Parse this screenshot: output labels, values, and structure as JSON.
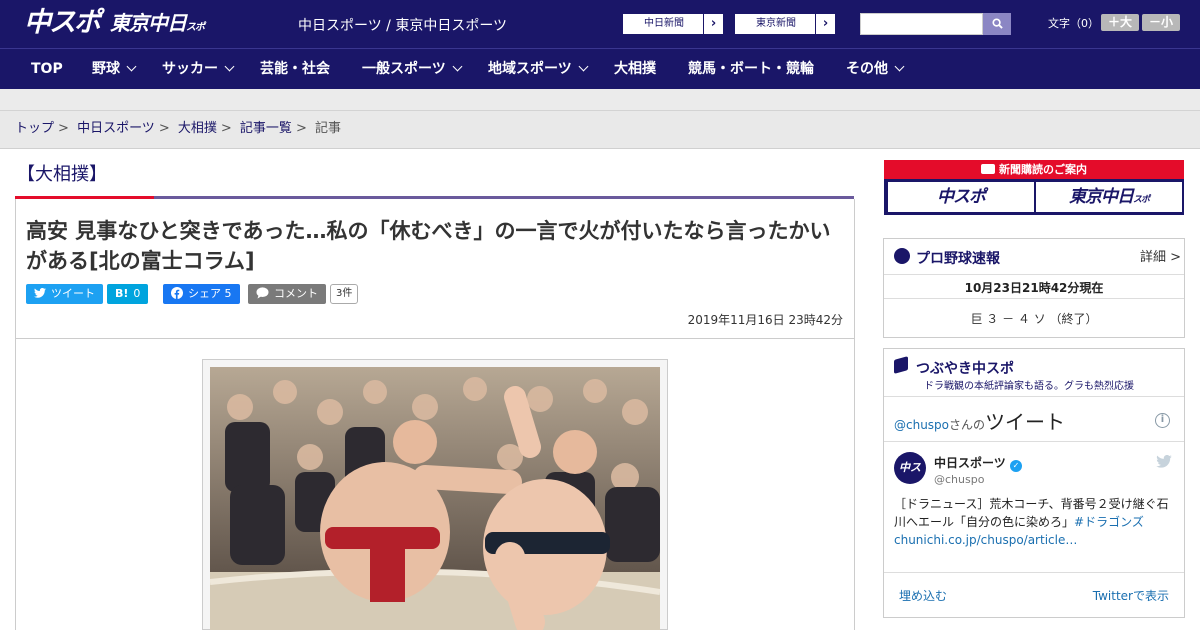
{
  "header": {
    "logo_chuspo": "中スポ",
    "logo_tokyo": "東京中日",
    "logo_tokyo_small": "スポ",
    "site_name": "中日スポーツ / 東京中日スポーツ",
    "ext_links": [
      {
        "label": "中日新聞",
        "arrow": "›"
      },
      {
        "label": "東京新聞",
        "arrow": "›"
      }
    ],
    "search_placeholder": "",
    "font_size_label": "文字（0）",
    "font_plus": "＋大",
    "font_minus": "－小"
  },
  "nav": {
    "items": [
      {
        "label": "TOP",
        "has_menu": false
      },
      {
        "label": "野球",
        "has_menu": true
      },
      {
        "label": "サッカー",
        "has_menu": true
      },
      {
        "label": "芸能・社会",
        "has_menu": false
      },
      {
        "label": "一般スポーツ",
        "has_menu": true
      },
      {
        "label": "地域スポーツ",
        "has_menu": true
      },
      {
        "label": "大相撲",
        "has_menu": false
      },
      {
        "label": "競馬・ボート・競輪",
        "has_menu": false
      },
      {
        "label": "その他",
        "has_menu": true
      }
    ]
  },
  "breadcrumb": {
    "items": [
      "トップ",
      "中日スポーツ",
      "大相撲",
      "記事一覧"
    ],
    "current": "記事",
    "sep": ">"
  },
  "article": {
    "category": "【大相撲】",
    "headline": "高安 見事なひと突きであった…私の「休むべき」の一言で火が付いたなら言ったかいがある[北の富士コラム]",
    "share": {
      "tweet": "ツイート",
      "hatena_icon": "B!",
      "hatena_count": "0",
      "facebook": "シェア",
      "facebook_count": "5",
      "comment": "コメント",
      "comment_count": "3件"
    },
    "date": "2019年11月16日 23時42分"
  },
  "sidebar": {
    "subscribe_title": "新聞購読のご案内",
    "subscribe_chuspo": "中スポ",
    "subscribe_tokyo": "東京中日",
    "subscribe_tokyo_small": "スポ",
    "baseball": {
      "title": "プロ野球速報",
      "more": "詳細 >",
      "timestamp": "10月23日21時42分現在",
      "score": "巨 ３ － ４ ソ （終了）"
    },
    "tweets": {
      "title": "つぶやき中スポ",
      "subtitle": "ドラ戦観の本紙評論家も語る。グラも熱烈応援",
      "handle": "@chuspo",
      "handle_suffix": "さんの",
      "tweets_label": "ツイート",
      "account_name": "中日スポーツ",
      "account_handle": "@chuspo",
      "tweet_text": "［ドラニュース］荒木コーチ、背番号２受け継ぐ石川へエール「自分の色に染めろ」",
      "tweet_hashtag": "#ドラゴンズ",
      "tweet_link": "chunichi.co.jp/chuspo/article…",
      "embed": "埋め込む",
      "view_on_twitter": "Twitterで表示"
    }
  },
  "colors": {
    "brand_navy": "#1a1668",
    "accent_red": "#e40c2a",
    "twitter_blue": "#1da1f2",
    "hatena_blue": "#00a4de",
    "facebook_blue": "#1877f2"
  }
}
